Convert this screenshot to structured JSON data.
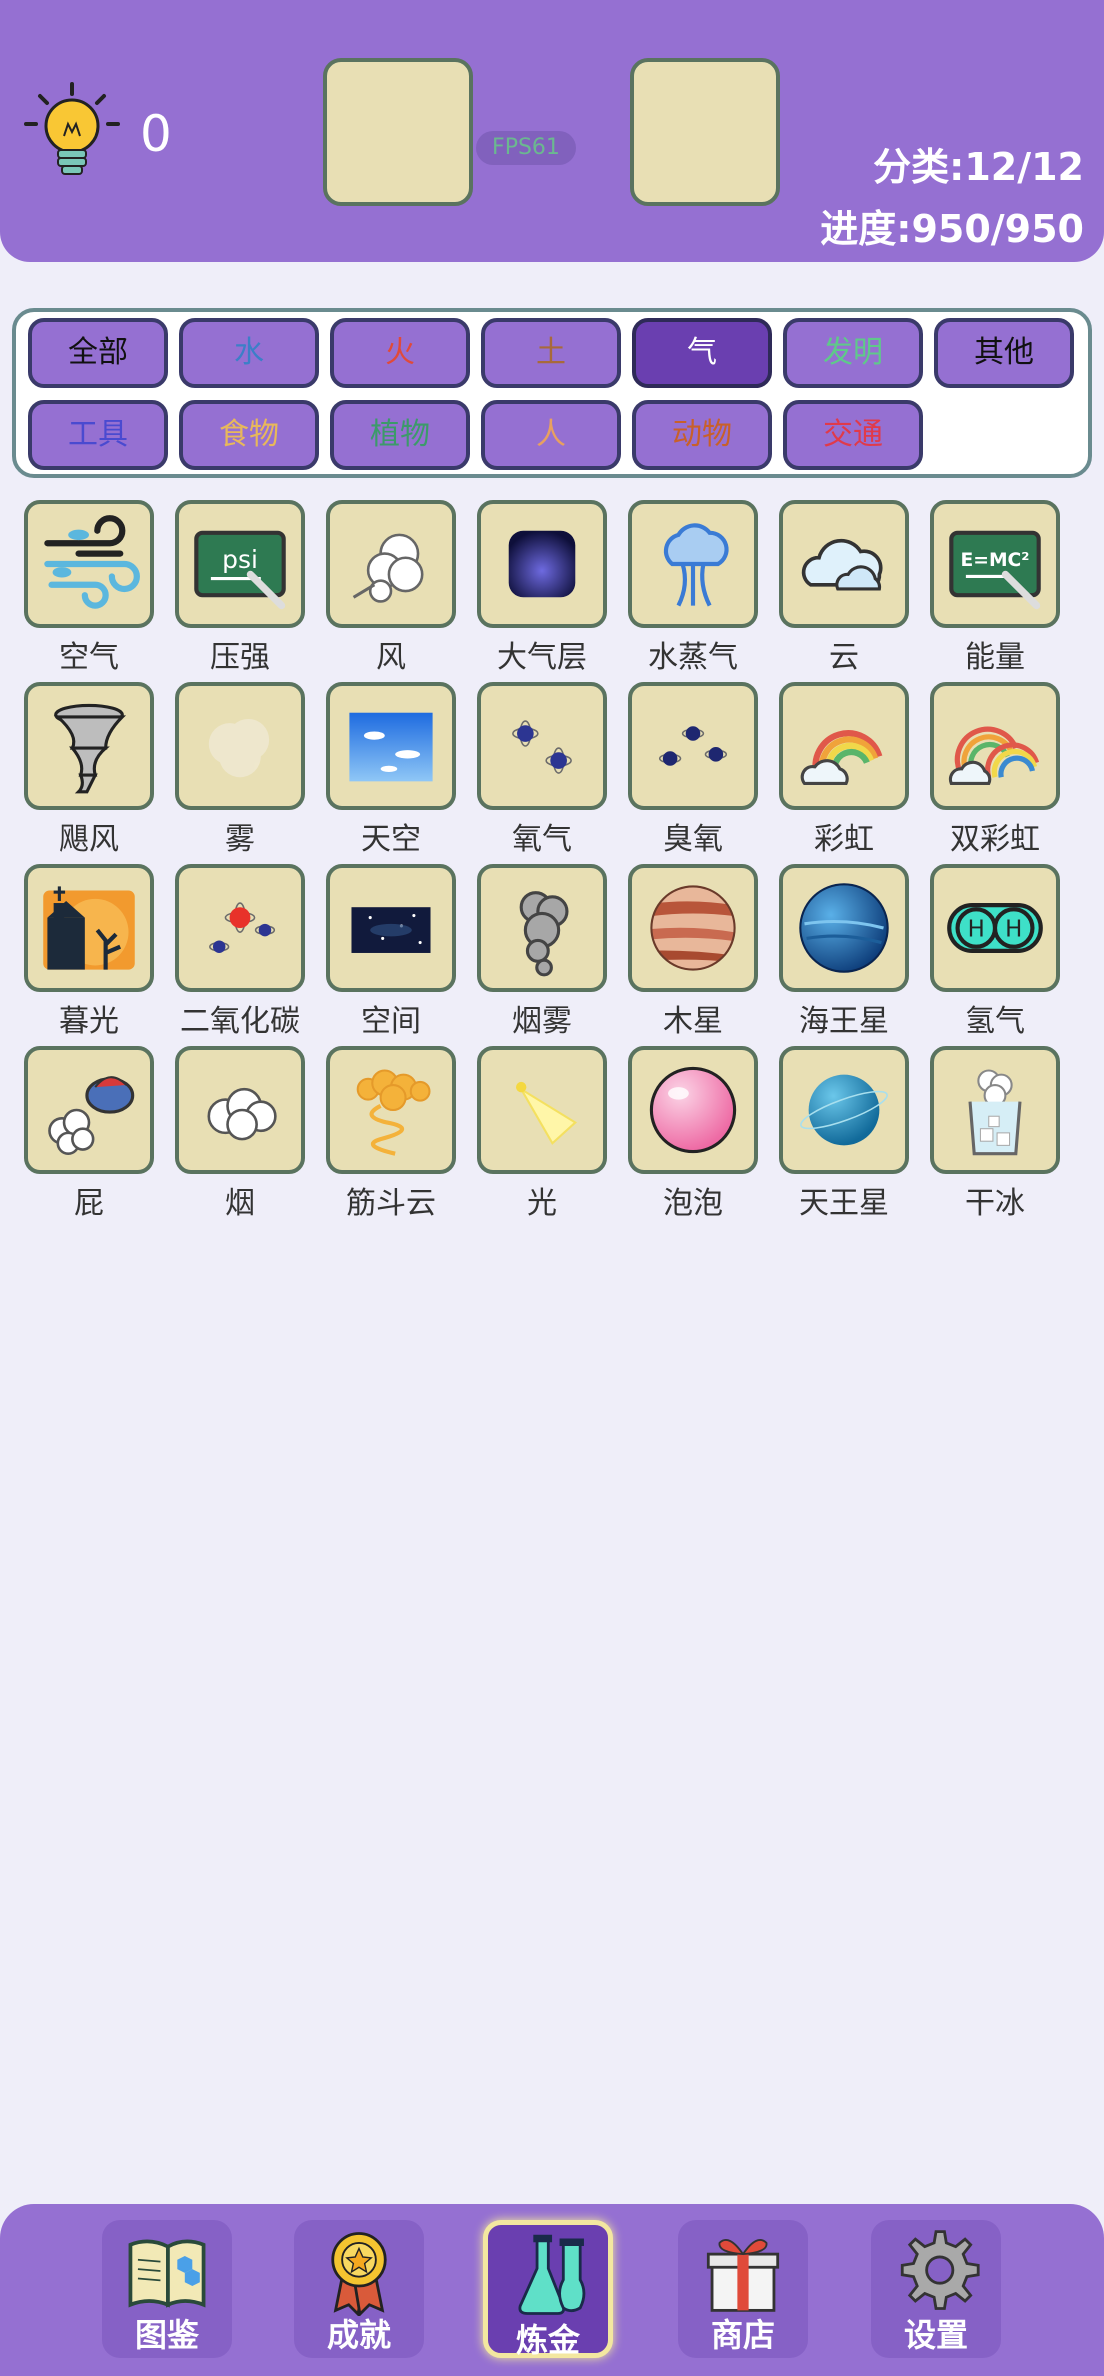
{
  "header": {
    "hint_count": "0",
    "fps": "FPS61",
    "category_progress": "分类:12/12",
    "progress": "进度:950/950"
  },
  "filters": [
    {
      "label": "全部",
      "color": "#111111"
    },
    {
      "label": "水",
      "color": "#3c7fc8"
    },
    {
      "label": "火",
      "color": "#e04a3a"
    },
    {
      "label": "土",
      "color": "#a86a3a"
    },
    {
      "label": "气",
      "color": "#ffffff",
      "selected": true
    },
    {
      "label": "发明",
      "color": "#5fc98a"
    },
    {
      "label": "其他",
      "color": "#111111"
    },
    {
      "label": "工具",
      "color": "#4a4ad0"
    },
    {
      "label": "食物",
      "color": "#e8b85a"
    },
    {
      "label": "植物",
      "color": "#3c9a6a"
    },
    {
      "label": "人",
      "color": "#e8a060"
    },
    {
      "label": "动物",
      "color": "#c8602a"
    },
    {
      "label": "交通",
      "color": "#e03a4a"
    }
  ],
  "elements": [
    {
      "label": "空气",
      "icon": "wind-air-icon"
    },
    {
      "label": "压强",
      "icon": "psi-board-icon"
    },
    {
      "label": "风",
      "icon": "gust-icon"
    },
    {
      "label": "大气层",
      "icon": "atmosphere-icon"
    },
    {
      "label": "水蒸气",
      "icon": "steam-icon"
    },
    {
      "label": "云",
      "icon": "cloud-icon"
    },
    {
      "label": "能量",
      "icon": "emc2-board-icon"
    },
    {
      "label": "飓风",
      "icon": "tornado-icon"
    },
    {
      "label": "雾",
      "icon": "fog-icon"
    },
    {
      "label": "天空",
      "icon": "sky-icon"
    },
    {
      "label": "氧气",
      "icon": "oxygen-icon"
    },
    {
      "label": "臭氧",
      "icon": "ozone-icon"
    },
    {
      "label": "彩虹",
      "icon": "rainbow-icon"
    },
    {
      "label": "双彩虹",
      "icon": "double-rainbow-icon"
    },
    {
      "label": "暮光",
      "icon": "twilight-icon"
    },
    {
      "label": "二氧化碳",
      "icon": "co2-icon"
    },
    {
      "label": "空间",
      "icon": "space-icon"
    },
    {
      "label": "烟雾",
      "icon": "smog-icon"
    },
    {
      "label": "木星",
      "icon": "jupiter-icon"
    },
    {
      "label": "海王星",
      "icon": "neptune-icon"
    },
    {
      "label": "氢气",
      "icon": "hydrogen-icon"
    },
    {
      "label": "屁",
      "icon": "fart-icon"
    },
    {
      "label": "烟",
      "icon": "smoke-icon"
    },
    {
      "label": "筋斗云",
      "icon": "somersault-cloud-icon"
    },
    {
      "label": "光",
      "icon": "light-icon"
    },
    {
      "label": "泡泡",
      "icon": "bubble-icon"
    },
    {
      "label": "天王星",
      "icon": "uranus-icon"
    },
    {
      "label": "干冰",
      "icon": "dry-ice-icon"
    }
  ],
  "nav": [
    {
      "label": "图鉴",
      "icon": "book-icon"
    },
    {
      "label": "成就",
      "icon": "medal-icon"
    },
    {
      "label": "炼金",
      "icon": "flask-icon",
      "active": true
    },
    {
      "label": "商店",
      "icon": "gift-icon"
    },
    {
      "label": "设置",
      "icon": "gear-icon"
    }
  ],
  "colors": {
    "header_bg": "#9570d2",
    "tile_bg": "#e8dfb4",
    "tile_border": "#5a735f",
    "page_bg": "#efeef9"
  }
}
